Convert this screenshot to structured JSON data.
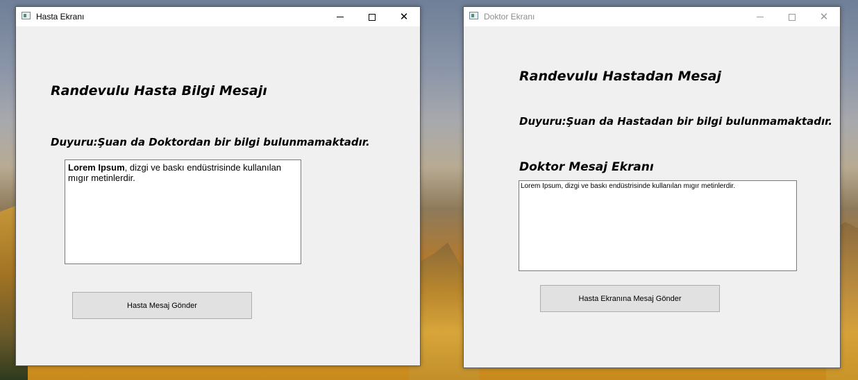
{
  "hasta_window": {
    "title": "Hasta Ekranı",
    "minimize_glyph": "",
    "maximize_glyph": "",
    "close_glyph": "✕",
    "heading": "Randevulu Hasta Bilgi Mesajı",
    "announcement": "Duyuru:Şuan da Doktordan bir bilgi bulunmamaktadır.",
    "message_bold": "Lorem Ipsum",
    "message_rest": ", dizgi ve baskı endüstrisinde kullanılan mıgır metinlerdir.",
    "send_button": "Hasta Mesaj Gönder"
  },
  "doktor_window": {
    "title": "Doktor Ekranı",
    "close_glyph": "✕",
    "heading": "Randevulu Hastadan Mesaj",
    "announcement": "Duyuru:Şuan da Hastadan bir bilgi bulunmamaktadır.",
    "message_label": "Doktor Mesaj Ekranı",
    "message_text": "Lorem Ipsum, dizgi ve baskı endüstrisinde kullanılan mıgır metinlerdir.",
    "send_button": "Hasta Ekranına Mesaj Gönder"
  }
}
